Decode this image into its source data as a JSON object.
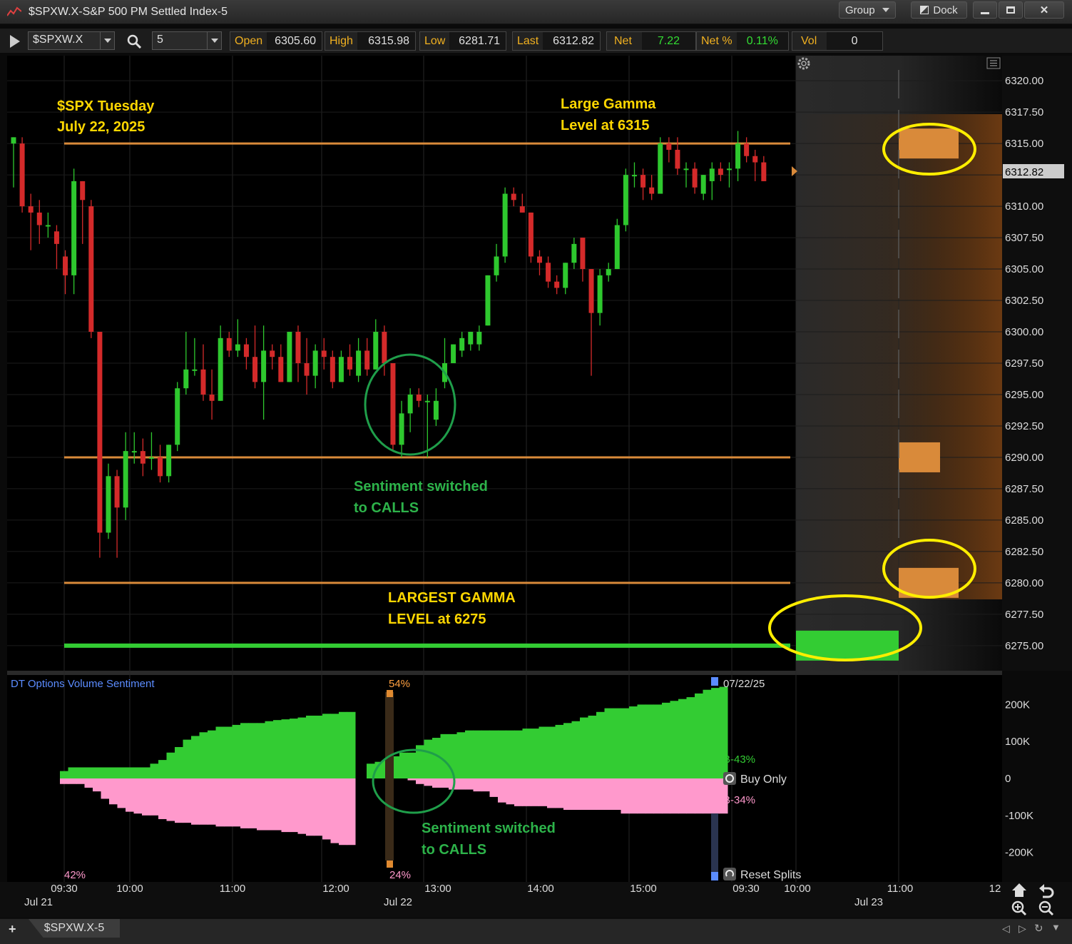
{
  "window": {
    "title": "$SPXW.X-S&P 500 PM Settled Index-5",
    "group_label": "Group",
    "dock_label": "Dock",
    "minimize": "▬",
    "maximize": "▣",
    "close": "✕"
  },
  "toolbar": {
    "symbol": "$SPXW.X",
    "interval": "5",
    "quote": [
      {
        "label": "Open",
        "value": "6305.60"
      },
      {
        "label": "High",
        "value": "6315.98"
      },
      {
        "label": "Low",
        "value": "6281.71"
      },
      {
        "label": "Last",
        "value": "6312.82"
      },
      {
        "label": "Net",
        "value": "7.22"
      },
      {
        "label": "Net %",
        "value": "0.11%"
      },
      {
        "label": "Vol",
        "value": "0"
      }
    ]
  },
  "annotations": {
    "title_l1": "$SPX Tuesday",
    "title_l2": "July 22, 2025",
    "gamma_l1": "Large Gamma",
    "gamma_l2": "Level at 6315",
    "largest_l1": "LARGEST GAMMA",
    "largest_l2": "LEVEL at 6275",
    "sentiment_l1": "Sentiment switched",
    "sentiment_l2": "to CALLS",
    "sentiment2_l1": "Sentiment switched",
    "sentiment2_l2": "to CALLS"
  },
  "price_axis": {
    "ticks": [
      "6320.00",
      "6317.50",
      "6315.00",
      "6312.50",
      "6310.00",
      "6307.50",
      "6305.00",
      "6302.50",
      "6300.00",
      "6297.50",
      "6295.00",
      "6292.50",
      "6290.00",
      "6287.50",
      "6285.00",
      "6282.50",
      "6280.00",
      "6277.50",
      "6275.00"
    ],
    "last_badge": "6312.82"
  },
  "lower_panel": {
    "title": "DT Options Volume Sentiment",
    "date": "07/22/25",
    "pct_top": "54%",
    "pct_bottom": "24%",
    "pct_left": "42%",
    "buy_label": "B-43%",
    "sell_label": "B-34%",
    "buy_only": "Buy Only",
    "reset_splits": "Reset Splits",
    "ticks": [
      "200K",
      "100K",
      "0",
      "-100K",
      "-200K"
    ]
  },
  "time_axis": {
    "times": [
      "09:30",
      "10:00",
      "11:00",
      "12:00",
      "13:00",
      "14:00",
      "15:00",
      "09:30",
      "10:00",
      "11:00",
      "12"
    ],
    "dates": [
      "Jul 21",
      "Jul 22",
      "Jul 23"
    ]
  },
  "tabs": {
    "active": "$SPXW.X-5"
  },
  "colors": {
    "up": "#2ec82e",
    "down": "#d42a2a",
    "gamma_line": "#d98a3a",
    "gamma_green": "#33cc33",
    "highlight": "#ffee00",
    "sentiment_green": "#33cc33",
    "sentiment_pink": "#ff99cc",
    "annotation_yellow": "#ffd700",
    "annotation_green": "#2db34a"
  },
  "chart_data": {
    "type": "candlestick",
    "title": "$SPX Tuesday July 22, 2025",
    "ylim": [
      6273,
      6322
    ],
    "gamma_levels": [
      {
        "level": 6315,
        "kind": "large"
      },
      {
        "level": 6290,
        "kind": "large"
      },
      {
        "level": 6280,
        "kind": "large"
      },
      {
        "level": 6275,
        "kind": "largest"
      }
    ],
    "candles": [
      [
        6315.0,
        6315.5,
        6311.5,
        6315.5
      ],
      [
        6315.0,
        6315.5,
        6309.5,
        6310.0
      ],
      [
        6310.0,
        6311.0,
        6306.5,
        6309.5
      ],
      [
        6309.5,
        6310.5,
        6307.0,
        6308.5
      ],
      [
        6308.5,
        6309.5,
        6307.5,
        6308.5
      ],
      [
        6308.0,
        6308.5,
        6305.0,
        6307.0
      ],
      [
        6306.0,
        6306.5,
        6303.0,
        6304.5
      ],
      [
        6304.5,
        6313.0,
        6303.0,
        6312.0
      ],
      [
        6312.0,
        6312.0,
        6307.0,
        6310.5
      ],
      [
        6310.0,
        6310.5,
        6299.5,
        6300.0
      ],
      [
        6300.0,
        6300.0,
        6282.0,
        6284.0
      ],
      [
        6284.0,
        6289.5,
        6283.5,
        6288.5
      ],
      [
        6288.5,
        6289.0,
        6282.0,
        6286.0
      ],
      [
        6286.0,
        6292.0,
        6285.0,
        6290.5
      ],
      [
        6290.5,
        6292.0,
        6289.5,
        6290.5
      ],
      [
        6290.5,
        6291.5,
        6288.5,
        6289.5
      ],
      [
        6290.0,
        6292.0,
        6289.0,
        6290.0
      ],
      [
        6290.0,
        6291.0,
        6288.0,
        6288.5
      ],
      [
        6288.5,
        6291.0,
        6288.0,
        6291.0
      ],
      [
        6291.0,
        6296.0,
        6290.5,
        6295.5
      ],
      [
        6295.5,
        6300.0,
        6295.0,
        6297.0
      ],
      [
        6297.0,
        6299.5,
        6296.5,
        6297.0
      ],
      [
        6297.0,
        6299.0,
        6294.5,
        6295.0
      ],
      [
        6295.0,
        6297.0,
        6293.0,
        6294.5
      ],
      [
        6294.5,
        6300.5,
        6294.5,
        6299.5
      ],
      [
        6299.5,
        6300.0,
        6298.0,
        6298.5
      ],
      [
        6298.5,
        6301.0,
        6298.0,
        6299.0
      ],
      [
        6299.0,
        6299.5,
        6297.0,
        6298.0
      ],
      [
        6298.0,
        6300.5,
        6295.5,
        6296.0
      ],
      [
        6296.0,
        6300.5,
        6293.0,
        6298.5
      ],
      [
        6298.5,
        6299.0,
        6297.0,
        6298.0
      ],
      [
        6298.0,
        6299.0,
        6296.0,
        6296.0
      ],
      [
        6296.0,
        6300.0,
        6296.0,
        6300.0
      ],
      [
        6300.0,
        6300.5,
        6296.0,
        6297.5
      ],
      [
        6297.5,
        6299.5,
        6295.0,
        6296.5
      ],
      [
        6296.5,
        6299.0,
        6295.5,
        6298.5
      ],
      [
        6298.5,
        6299.5,
        6297.0,
        6298.0
      ],
      [
        6298.0,
        6298.5,
        6295.5,
        6296.0
      ],
      [
        6296.0,
        6298.5,
        6296.0,
        6298.0
      ],
      [
        6298.0,
        6299.0,
        6296.5,
        6297.0
      ],
      [
        6296.5,
        6299.5,
        6296.0,
        6298.5
      ],
      [
        6298.5,
        6299.5,
        6296.5,
        6297.0
      ],
      [
        6297.0,
        6301.0,
        6297.0,
        6300.0
      ],
      [
        6300.0,
        6300.5,
        6296.5,
        6297.5
      ],
      [
        6297.5,
        6297.5,
        6290.5,
        6291.0
      ],
      [
        6291.0,
        6294.5,
        6290.0,
        6293.5
      ],
      [
        6293.5,
        6295.5,
        6292.0,
        6295.0
      ],
      [
        6295.0,
        6295.5,
        6294.0,
        6294.5
      ],
      [
        6294.5,
        6295.0,
        6290.0,
        6294.5
      ],
      [
        6293.0,
        6295.5,
        6292.5,
        6294.5
      ],
      [
        6296.0,
        6299.5,
        6295.5,
        6297.5
      ],
      [
        6297.5,
        6299.0,
        6297.5,
        6299.0
      ],
      [
        6298.5,
        6300.0,
        6298.0,
        6299.5
      ],
      [
        6299.0,
        6300.0,
        6298.5,
        6300.0
      ],
      [
        6299.0,
        6300.5,
        6298.5,
        6300.0
      ],
      [
        6300.5,
        6304.5,
        6300.5,
        6304.5
      ],
      [
        6304.5,
        6307.0,
        6304.0,
        6306.0
      ],
      [
        6306.0,
        6311.5,
        6305.5,
        6311.0
      ],
      [
        6311.0,
        6311.5,
        6310.0,
        6310.5
      ],
      [
        6310.0,
        6311.0,
        6309.5,
        6309.5
      ],
      [
        6309.5,
        6309.5,
        6305.5,
        6306.0
      ],
      [
        6306.0,
        6306.5,
        6304.5,
        6305.5
      ],
      [
        6305.5,
        6306.0,
        6303.5,
        6304.0
      ],
      [
        6304.0,
        6304.5,
        6303.0,
        6303.5
      ],
      [
        6303.5,
        6305.5,
        6303.0,
        6305.5
      ],
      [
        6305.5,
        6307.5,
        6305.0,
        6307.0
      ],
      [
        6307.5,
        6307.5,
        6304.0,
        6305.0
      ],
      [
        6305.0,
        6305.0,
        6296.5,
        6301.5
      ],
      [
        6301.5,
        6305.0,
        6300.5,
        6304.5
      ],
      [
        6304.5,
        6305.5,
        6304.0,
        6305.0
      ],
      [
        6305.0,
        6309.0,
        6305.0,
        6308.5
      ],
      [
        6308.5,
        6313.0,
        6308.0,
        6312.5
      ],
      [
        6312.5,
        6313.5,
        6311.5,
        6312.5
      ],
      [
        6312.5,
        6313.0,
        6310.5,
        6311.5
      ],
      [
        6311.5,
        6312.5,
        6310.5,
        6311.0
      ],
      [
        6311.0,
        6315.5,
        6311.0,
        6315.0
      ],
      [
        6315.0,
        6315.5,
        6313.5,
        6314.5
      ],
      [
        6314.5,
        6315.5,
        6312.5,
        6313.0
      ],
      [
        6313.0,
        6313.5,
        6311.5,
        6313.0
      ],
      [
        6313.0,
        6313.5,
        6311.0,
        6311.5
      ],
      [
        6311.0,
        6312.5,
        6310.5,
        6312.5
      ],
      [
        6312.0,
        6313.5,
        6310.5,
        6313.0
      ],
      [
        6313.0,
        6313.5,
        6312.0,
        6312.5
      ],
      [
        6313.0,
        6313.5,
        6311.5,
        6313.0
      ],
      [
        6313.0,
        6316.0,
        6312.0,
        6315.0
      ],
      [
        6315.0,
        6315.5,
        6313.5,
        6314.0
      ],
      [
        6314.0,
        6314.5,
        6312.0,
        6313.5
      ],
      [
        6313.5,
        6314.0,
        6312.0,
        6312.0
      ]
    ],
    "sentiment": {
      "buy_k": [
        20,
        30,
        30,
        30,
        30,
        30,
        30,
        30,
        30,
        30,
        30,
        40,
        50,
        70,
        85,
        105,
        115,
        125,
        130,
        140,
        140,
        145,
        150,
        150,
        150,
        155,
        158,
        160,
        162,
        165,
        170,
        170,
        175,
        175,
        180,
        180,
        40,
        45,
        50,
        60,
        70,
        70,
        90,
        105,
        110,
        120,
        120,
        125,
        130,
        130,
        130,
        130,
        130,
        130,
        130,
        135,
        135,
        140,
        140,
        145,
        150,
        155,
        165,
        170,
        180,
        190,
        190,
        190,
        195,
        200,
        200,
        200,
        205,
        210,
        215,
        220,
        230,
        240,
        245,
        248
      ],
      "sell_k": [
        -15,
        -15,
        -15,
        -25,
        -35,
        -55,
        -70,
        -80,
        -90,
        -95,
        -100,
        -100,
        -110,
        -115,
        -120,
        -120,
        -125,
        -125,
        -125,
        -130,
        -130,
        -130,
        -135,
        -135,
        -140,
        -140,
        -140,
        -145,
        -145,
        -150,
        -155,
        -155,
        -165,
        -175,
        -180,
        -180,
        0,
        0,
        0,
        0,
        0,
        -5,
        -15,
        -20,
        -25,
        -25,
        -30,
        -30,
        -30,
        -35,
        -35,
        -50,
        -65,
        -70,
        -75,
        -75,
        -75,
        -75,
        -80,
        -80,
        -85,
        -85,
        -85,
        -85,
        -85,
        -85,
        -85,
        -95,
        -95,
        -95,
        -95,
        -95,
        -95,
        -95,
        -95,
        -95,
        -95,
        -95,
        -95,
        -95
      ]
    },
    "ylim_sentiment_k": [
      -280,
      280
    ]
  }
}
